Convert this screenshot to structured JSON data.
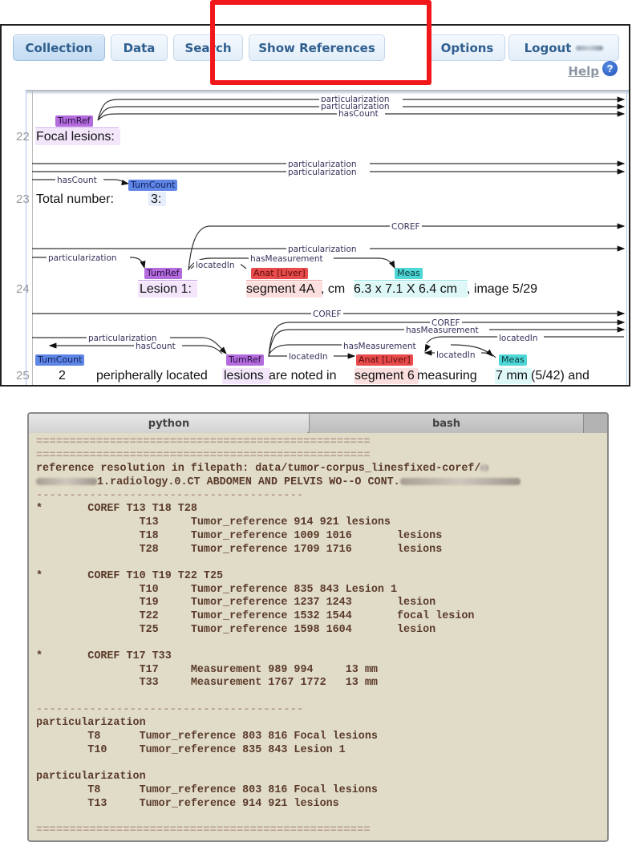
{
  "toolbar": {
    "buttons": [
      {
        "label": "Collection",
        "active": true
      },
      {
        "label": "Data"
      },
      {
        "label": "Search"
      },
      {
        "label": "Show References"
      },
      {
        "label": "Options"
      },
      {
        "label": "Logout"
      }
    ],
    "help_label": "Help",
    "help_icon": "question-circle-icon"
  },
  "colors": {
    "highlight": "#f2171a",
    "TumRef": "#b36bde",
    "TumCount": "#5f86e6",
    "Anat": "#e84b4b",
    "Meas": "#4fd6d6",
    "terminal_bg": "#e1dcc7",
    "terminal_text": "#5a3a2a"
  },
  "document": {
    "lines": [
      {
        "no": "22",
        "segments": [
          "Focal lesions:"
        ]
      },
      {
        "no": "23",
        "segments": [
          "Total number:",
          "3:"
        ]
      },
      {
        "no": "24",
        "segments": [
          "Lesion 1:",
          "segment 4A",
          ", cm ",
          "6.3 x 7.1 X 6.4 cm",
          ", image 5/29"
        ]
      },
      {
        "no": "25",
        "segments": [
          "2",
          "peripherally located ",
          "lesions",
          " are noted in ",
          "segment 6",
          " measuring ",
          "7 mm",
          " (5/42) and"
        ]
      }
    ],
    "tags": {
      "tumref": "TumRef",
      "tumcount": "TumCount",
      "anat": "Anat [Liver]",
      "meas": "Meas"
    },
    "relations": {
      "particularization": "particularization",
      "hasCount": "hasCount",
      "locatedIn": "locatedIn",
      "hasMeasurement": "hasMeasurement",
      "coref": "COREF"
    }
  },
  "terminal": {
    "tabs": [
      {
        "label": "python",
        "active": true
      },
      {
        "label": "bash"
      }
    ],
    "lines": [
      {
        "type": "sep",
        "text": "=================================================="
      },
      {
        "type": "sep",
        "text": "=================================================="
      },
      {
        "type": "text",
        "text": "reference resolution in filepath: data/tumor-corpus_linesfixed-coref/"
      },
      {
        "type": "redacted-path",
        "text": "1.radiology.0.CT ABDOMEN AND PELVIS WO--O CONT."
      },
      {
        "type": "sep",
        "text": "----------------------------------------"
      },
      {
        "type": "text",
        "text": "*       COREF T13 T18 T28"
      },
      {
        "type": "text",
        "text": "                T13     Tumor_reference 914 921 lesions"
      },
      {
        "type": "text",
        "text": "                T18     Tumor_reference 1009 1016       lesions"
      },
      {
        "type": "text",
        "text": "                T28     Tumor_reference 1709 1716       lesions"
      },
      {
        "type": "text",
        "text": ""
      },
      {
        "type": "text",
        "text": "*       COREF T10 T19 T22 T25"
      },
      {
        "type": "text",
        "text": "                T10     Tumor_reference 835 843 Lesion 1"
      },
      {
        "type": "text",
        "text": "                T19     Tumor_reference 1237 1243       lesion"
      },
      {
        "type": "text",
        "text": "                T22     Tumor_reference 1532 1544       focal lesion"
      },
      {
        "type": "text",
        "text": "                T25     Tumor_reference 1598 1604       lesion"
      },
      {
        "type": "text",
        "text": ""
      },
      {
        "type": "text",
        "text": "*       COREF T17 T33"
      },
      {
        "type": "text",
        "text": "                T17     Measurement 989 994     13 mm"
      },
      {
        "type": "text",
        "text": "                T33     Measurement 1767 1772   13 mm"
      },
      {
        "type": "text",
        "text": ""
      },
      {
        "type": "sep",
        "text": "----------------------------------------"
      },
      {
        "type": "text",
        "text": "particularization"
      },
      {
        "type": "text",
        "text": "        T8      Tumor_reference 803 816 Focal lesions"
      },
      {
        "type": "text",
        "text": "        T10     Tumor_reference 835 843 Lesion 1"
      },
      {
        "type": "text",
        "text": ""
      },
      {
        "type": "text",
        "text": "particularization"
      },
      {
        "type": "text",
        "text": "        T8      Tumor_reference 803 816 Focal lesions"
      },
      {
        "type": "text",
        "text": "        T13     Tumor_reference 914 921 lesions"
      },
      {
        "type": "text",
        "text": ""
      },
      {
        "type": "sep",
        "text": "=================================================="
      }
    ]
  }
}
